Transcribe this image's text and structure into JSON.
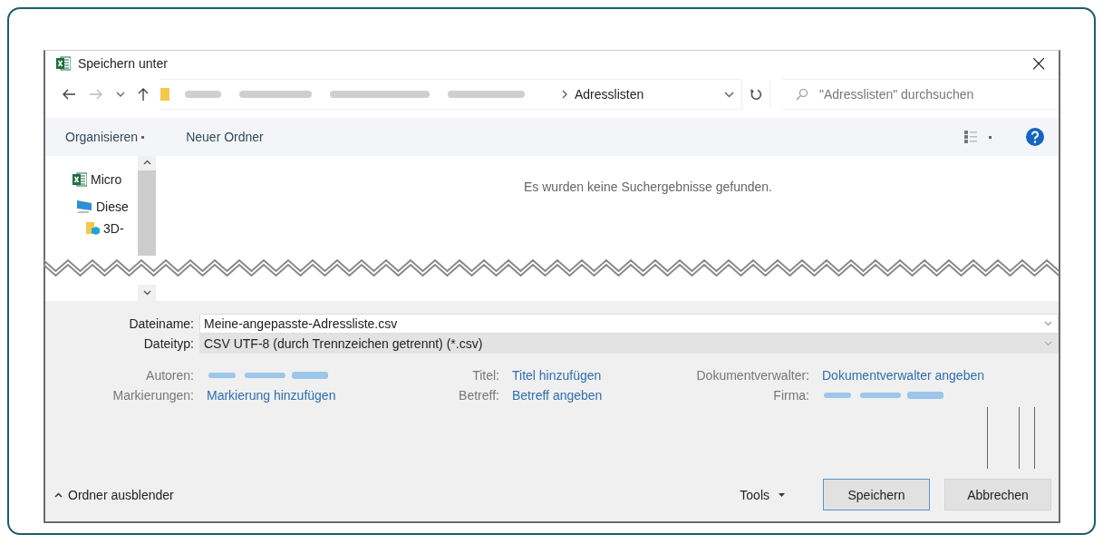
{
  "window": {
    "title": "Speichern unter",
    "close": "×"
  },
  "nav": {
    "location": "Adresslisten",
    "search_placeholder": "\"Adresslisten\" durchsuchen"
  },
  "toolbar": {
    "organize": "Organisieren",
    "new_folder": "Neuer Ordner"
  },
  "sidebar": {
    "items": [
      {
        "label": "Micro",
        "kind": "excel"
      },
      {
        "label": "Diese",
        "kind": "computer"
      },
      {
        "label": "3D-",
        "kind": "folder"
      }
    ]
  },
  "empty_message": "Es wurden keine Suchergebnisse gefunden.",
  "fields": [
    {
      "label": "Dateiname:",
      "value": "Meine-angepasste-Adressliste.csv",
      "kind": "input"
    },
    {
      "label": "Dateityp:",
      "value": "CSV UTF-8 (durch Trennzeichen getrennt) (*.csv)",
      "kind": "select"
    }
  ],
  "metadata": [
    {
      "label": "Autoren:",
      "kind": "blurred"
    },
    {
      "label": "Titel:",
      "value": "Titel hinzufügen",
      "kind": "link"
    },
    {
      "label": "Dokumentverwalter:",
      "value": "Dokumentverwalter angeben",
      "kind": "link"
    },
    {
      "label": "Markierungen:",
      "value": "Markierung hinzufügen",
      "kind": "link"
    },
    {
      "label": "Betreff:",
      "value": "Betreff angeben",
      "kind": "link"
    },
    {
      "label": "Firma:",
      "kind": "blurred"
    }
  ],
  "footer": {
    "hide_folders": "Ordner ausblender",
    "tools": "Tools",
    "buttons": [
      {
        "label": "Speichern",
        "default": true
      },
      {
        "label": "Abbrechen",
        "default": false
      }
    ]
  }
}
